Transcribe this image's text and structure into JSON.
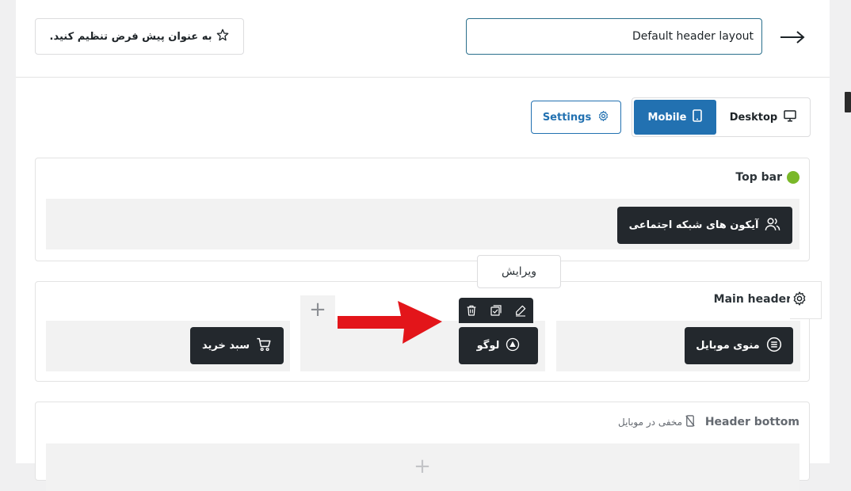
{
  "header": {
    "layout_name_value": "Default header layout",
    "set_default_label": "به عنوان پیش فرض تنظیم کنید."
  },
  "device_tabs": {
    "desktop_label": "Desktop",
    "mobile_label": "Mobile",
    "active": "Mobile"
  },
  "settings_label": "Settings",
  "sections": {
    "top_bar": {
      "title": "Top bar",
      "status_color": "#7ab829",
      "items": {
        "social_icons": "آیکون های شبکه اجتماعی"
      }
    },
    "main_header": {
      "title": "Main header",
      "items": {
        "mobile_menu": "منوی موبایل",
        "logo": "لوگو",
        "cart": "سبد خرید"
      },
      "add_symbol": "+"
    },
    "header_bottom": {
      "title": "Header bottom",
      "hidden_note": "مخفی در موبایل",
      "add_symbol": "+"
    }
  },
  "tooltip": {
    "edit_label": "ویرایش"
  },
  "icons": {
    "back": "arrow-right-icon",
    "star": "star-icon",
    "desktop": "monitor-icon",
    "mobile": "smartphone-icon",
    "settings": "gear-icon",
    "social": "users-icon",
    "menu": "hamburger-circle-icon",
    "logo": "logo-triangle-icon",
    "cart": "cart-icon",
    "edit": "pencil-icon",
    "duplicate": "copy-check-icon",
    "delete": "trash-icon",
    "hidden": "mobile-off-icon"
  },
  "colors": {
    "accent": "#2271b1",
    "chip_bg": "#23282d",
    "annotation": "#e3151a"
  }
}
